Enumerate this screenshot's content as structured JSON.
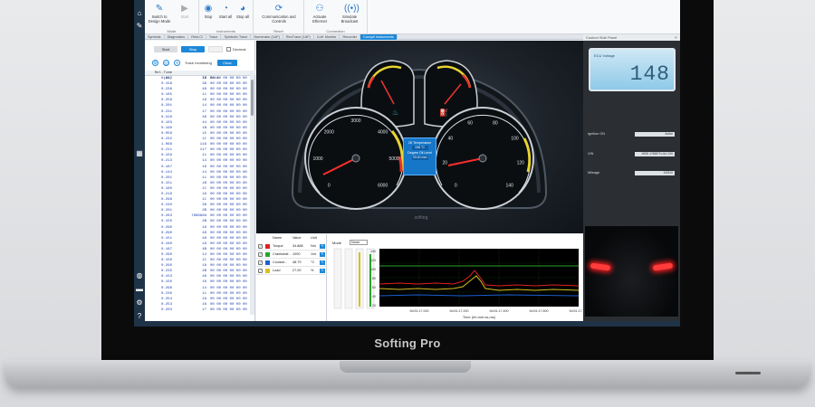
{
  "brand": "Softing Pro",
  "ribbon": {
    "groups": [
      {
        "label": "Mode",
        "buttons": [
          "Switch to Design Mode",
          "Start"
        ]
      },
      {
        "label": "Instruments",
        "buttons": [
          "Stop",
          "Start all",
          "Stop all"
        ]
      },
      {
        "label": "Reset",
        "buttons": [
          "Communication and Controls"
        ]
      },
      {
        "label": "Connection",
        "buttons": [
          "Activate Ethernet",
          "Simulate Broadcast"
        ]
      }
    ]
  },
  "tabs": [
    "Symbols",
    "Diagnostics",
    "Rest-Cl",
    "Trace",
    "Symbolic Trace",
    "Numerator (1AF)",
    "RecTrace (1AF)",
    "Coff. Monitor",
    "Recorder",
    "Cockpit Instruments"
  ],
  "trace_panel": {
    "start_label": "Start",
    "stop_label": "Stop",
    "clear_label": "Clear",
    "monitor_label": "Trace monitoring",
    "decimal_label": "Decimal",
    "col_time": "Rel.Time (ms)",
    "col_id": "ID",
    "col_data": "Data",
    "rows": [
      [
        "0.287",
        "18",
        "00 00 00 00 00 00"
      ],
      [
        "0.158",
        "38",
        "00 00 00 00 00 00"
      ],
      [
        "0.238",
        "48",
        "00 00 00 00 00 00"
      ],
      [
        "0.185",
        "11",
        "00 00 00 00 00 00"
      ],
      [
        "0.258",
        "16",
        "00 00 00 00 00 00"
      ],
      [
        "0.201",
        "14",
        "00 00 00 00 00 00"
      ],
      [
        "0.231",
        "17",
        "00 00 00 00 00 00"
      ],
      [
        "0.318",
        "48",
        "00 00 00 00 00 00"
      ],
      [
        "0.103",
        "44",
        "00 00 00 00 00 00"
      ],
      [
        "0.190",
        "1B",
        "00 00 00 00 00 00"
      ],
      [
        "0.058",
        "15",
        "00 00 00 00 00 00"
      ],
      [
        "0.232",
        "1C",
        "00 00 00 00 00 00"
      ],
      [
        "1.066",
        "116",
        "00 00 00 00 00 00"
      ],
      [
        "0.211",
        "117",
        "00 00 00 00 00 00"
      ],
      [
        "0.159",
        "11",
        "00 00 00 00 00 00"
      ],
      [
        "0.213",
        "14",
        "00 00 00 00 00 00"
      ],
      [
        "0.187",
        "16",
        "00 00 00 00 00 00"
      ],
      [
        "0.144",
        "14",
        "00 00 00 00 00 00"
      ],
      [
        "0.201",
        "11",
        "00 00 00 00 00 00"
      ],
      [
        "0.151",
        "1B",
        "00 00 00 00 00 00"
      ],
      [
        "0.160",
        "1C",
        "00 00 00 00 00 00"
      ],
      [
        "0.219",
        "18",
        "00 00 00 00 00 00"
      ],
      [
        "0.296",
        "1C",
        "00 00 00 00 00 00"
      ],
      [
        "0.240",
        "38",
        "00 00 00 00 00 00"
      ],
      [
        "0.201",
        "2B",
        "00 00 00 00 00 00"
      ],
      [
        "0.263",
        "7888888",
        "00 00 00 00 00 00"
      ],
      [
        "0.150",
        "2B",
        "00 00 00 00 00 00"
      ],
      [
        "0.290",
        "16",
        "00 00 00 00 00 00"
      ],
      [
        "0.290",
        "48",
        "00 00 00 00 00 00"
      ],
      [
        "0.151",
        "48",
        "00 00 00 00 00 00"
      ],
      [
        "0.190",
        "18",
        "00 00 00 00 00 00"
      ],
      [
        "0.187",
        "4B",
        "00 00 00 00 00 00"
      ],
      [
        "0.290",
        "14",
        "00 00 00 00 00 00"
      ],
      [
        "0.150",
        "1C",
        "00 00 00 00 00 00"
      ],
      [
        "0.290",
        "18",
        "00 00 00 00 00 00"
      ],
      [
        "0.235",
        "2B",
        "00 00 00 00 00 00"
      ],
      [
        "0.153",
        "48",
        "00 00 00 00 00 00"
      ],
      [
        "0.150",
        "16",
        "00 00 00 00 00 00"
      ],
      [
        "0.296",
        "14",
        "00 00 00 00 00 00"
      ],
      [
        "0.230",
        "11",
        "00 00 00 00 00 00"
      ],
      [
        "0.254",
        "18",
        "00 00 00 00 00 00"
      ],
      [
        "0.253",
        "16",
        "00 00 00 00 00 00"
      ],
      [
        "0.203",
        "17",
        "00 00 00 00 00 00"
      ]
    ]
  },
  "dashboard": {
    "oil_temp_label": "Oil Temperature",
    "oil_temp_value": "106",
    "oil_temp_unit": "°C",
    "oil_level_label": "Degree Oil Level",
    "oil_level_value": "76.00",
    "oil_level_unit": "mm",
    "logo": "softing",
    "left_gauge": {
      "ticks": [
        "0",
        "1000",
        "2000",
        "3000",
        "4000",
        "5000",
        "6000"
      ]
    },
    "right_gauge": {
      "ticks": [
        "0",
        "20",
        "40",
        "60",
        "80",
        "100",
        "120",
        "140"
      ]
    }
  },
  "signals": {
    "col_name": "Name",
    "col_value": "Value",
    "col_unit": "Unit",
    "rows": [
      {
        "name": "Torque",
        "value": "34.888",
        "unit": "Nm",
        "color": "#e02020"
      },
      {
        "name": "Crankshaf...",
        "value": "1000",
        "unit": "1/m",
        "color": "#2aa52a"
      },
      {
        "name": "Coolant...",
        "value": "48.79",
        "unit": "°C",
        "color": "#1a5fd0"
      },
      {
        "name": "Load",
        "value": "27.00",
        "unit": "%",
        "color": "#d8c020"
      }
    ]
  },
  "plot": {
    "mode_label": "Mode",
    "mode_value": "None",
    "xlabel": "Time (hh:mm:ss,ms)",
    "xticks": [
      "9d:51:17.000",
      "9d:51:17.200",
      "9d:51:17.400",
      "9d:51:17.600",
      "9d:51:17.800"
    ],
    "yticks": [
      "140",
      "120",
      "100",
      "80",
      "60",
      "40",
      "20"
    ]
  },
  "side_panel": {
    "title": "Custom Side Panel",
    "lcd_label": "ECU Voltage",
    "lcd_value": "148",
    "rows": [
      {
        "label": "Ignition ON",
        "value": "Active"
      },
      {
        "label": "VIN",
        "value": "WDD 1756873 UAJ 1X6"
      },
      {
        "label": "Mileage",
        "value": "102510"
      }
    ]
  }
}
